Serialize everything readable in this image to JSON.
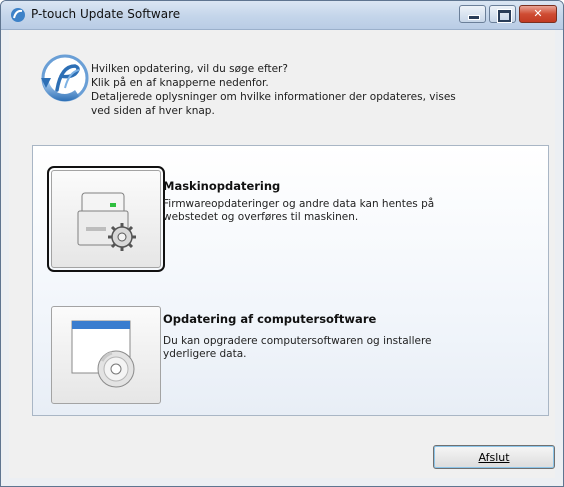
{
  "window": {
    "title": "P-touch Update Software"
  },
  "intro": {
    "lines": [
      "Hvilken opdatering, vil du søge efter?",
      "Klik på en af knapperne nedenfor.",
      "Detaljerede oplysninger om hvilke informationer der opdateres, vises",
      "ved siden af hver knap."
    ]
  },
  "options": [
    {
      "title": "Maskinopdatering",
      "desc_lines": [
        "Firmwareopdateringer og andre data kan hentes på",
        "webstedet og overføres til maskinen."
      ],
      "icon": "printer-gear-icon"
    },
    {
      "title": "Opdatering af computersoftware",
      "desc_lines": [
        "Du kan opgradere computersoftwaren og installere",
        "yderligere data."
      ],
      "icon": "window-cd-icon"
    }
  ],
  "footer": {
    "close_label": "Afslut"
  },
  "colors": {
    "titlebar": "#c4d5ea",
    "close_button": "#cf4c33",
    "panel_border": "#a9b6c5"
  }
}
